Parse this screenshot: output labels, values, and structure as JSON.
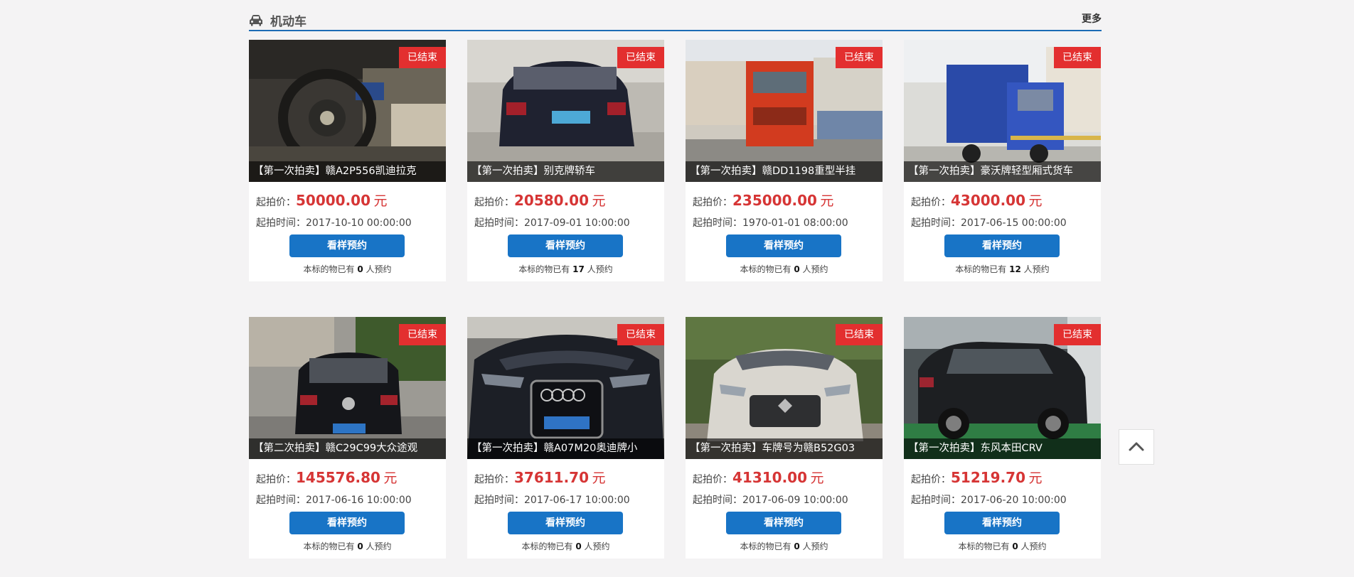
{
  "section": {
    "title": "机动车",
    "icon": "car-icon",
    "more_label": "更多",
    "accent_color": "#1c6cb5"
  },
  "labels": {
    "price_prefix": "起拍价：",
    "time_prefix": "起拍时间：",
    "unit": "元",
    "book_button": "看样预约",
    "reserve_prefix": "本标的物已有",
    "reserve_suffix": "人预约"
  },
  "colors": {
    "badge": "#e32f2f",
    "price": "#d63535",
    "button": "#1874c6"
  },
  "items": [
    {
      "status": "已结束",
      "title": "【第一次拍卖】赣A2P556凯迪拉克",
      "price": "50000.00",
      "start_time": "2017-10-10 00:00:00",
      "reservations": "0",
      "photo": "car-interior-photo"
    },
    {
      "status": "已结束",
      "title": "【第一次拍卖】别克牌轿车",
      "price": "20580.00",
      "start_time": "2017-09-01 10:00:00",
      "reservations": "17",
      "photo": "black-sedan-rear-photo"
    },
    {
      "status": "已结束",
      "title": "【第一次拍卖】赣DD1198重型半挂",
      "price": "235000.00",
      "start_time": "1970-01-01 08:00:00",
      "reservations": "0",
      "photo": "red-truck-photo"
    },
    {
      "status": "已结束",
      "title": "【第一次拍卖】豪沃牌轻型厢式货车",
      "price": "43000.00",
      "start_time": "2017-06-15 00:00:00",
      "reservations": "12",
      "photo": "blue-box-truck-photo"
    },
    {
      "status": "已结束",
      "title": "【第二次拍卖】赣C29C99大众途观",
      "price": "145576.80",
      "start_time": "2017-06-16 10:00:00",
      "reservations": "0",
      "photo": "vw-suv-rear-photo"
    },
    {
      "status": "已结束",
      "title": "【第一次拍卖】赣A07M20奥迪牌小",
      "price": "37611.70",
      "start_time": "2017-06-17 10:00:00",
      "reservations": "0",
      "photo": "audi-front-photo"
    },
    {
      "status": "已结束",
      "title": "【第一次拍卖】车牌号为赣B52G03",
      "price": "41310.00",
      "start_time": "2017-06-09 10:00:00",
      "reservations": "0",
      "photo": "white-car-front-photo"
    },
    {
      "status": "已结束",
      "title": "【第一次拍卖】东风本田CRV",
      "price": "51219.70",
      "start_time": "2017-06-20 10:00:00",
      "reservations": "0",
      "photo": "crv-parking-photo"
    }
  ],
  "back_to_top_icon": "chevron-up-icon"
}
